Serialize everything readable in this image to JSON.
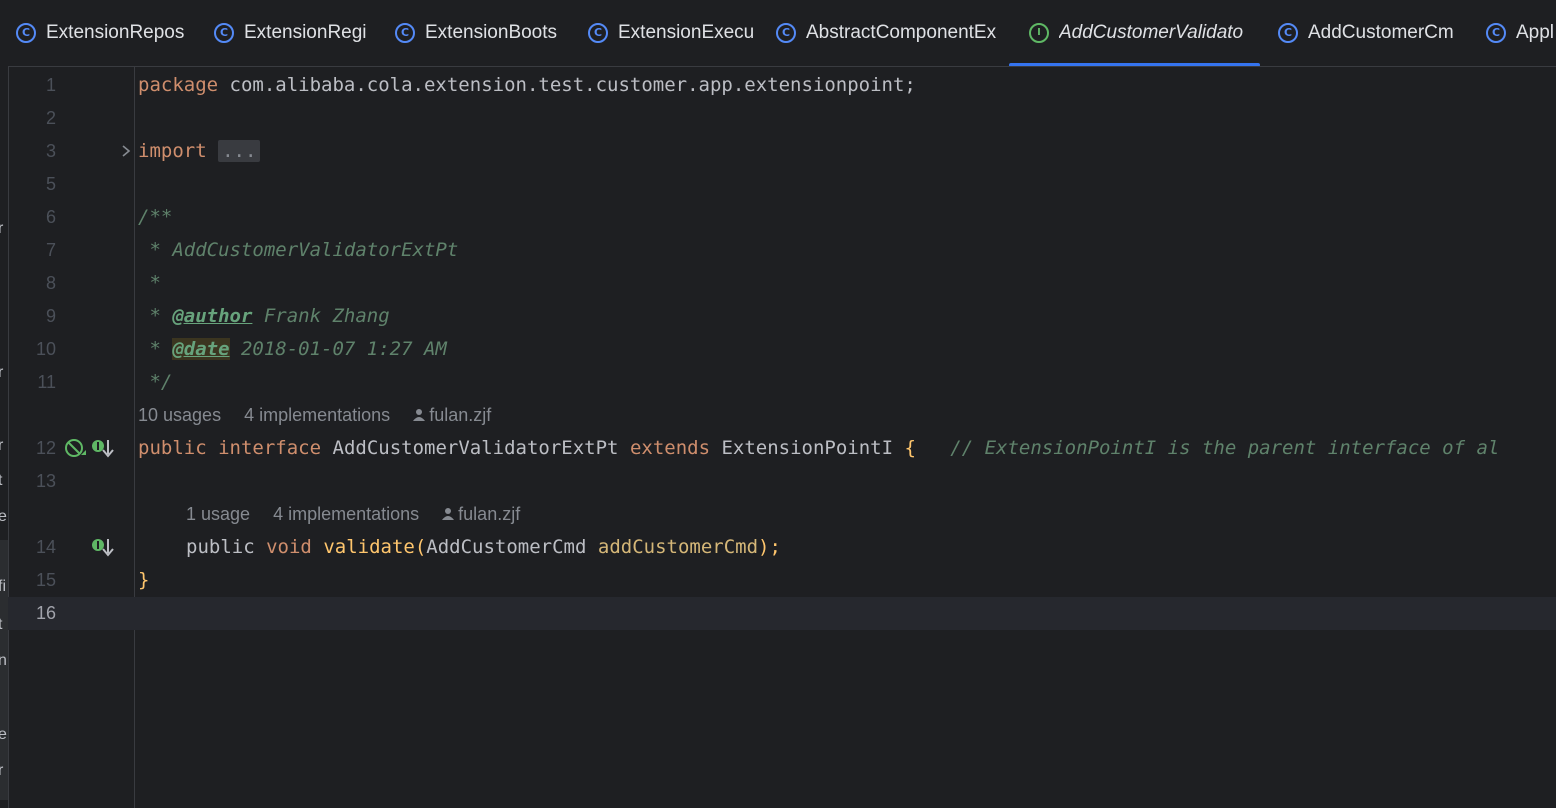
{
  "tabs": [
    {
      "label": "ExtensionRepos",
      "kind": "class"
    },
    {
      "label": "ExtensionRegi",
      "kind": "class"
    },
    {
      "label": "ExtensionBoots",
      "kind": "class"
    },
    {
      "label": "ExtensionExecu",
      "kind": "class"
    },
    {
      "label": "AbstractComponentEx",
      "kind": "class"
    },
    {
      "label": "AddCustomerValidato",
      "kind": "interface",
      "active": true
    },
    {
      "label": "AddCustomerCm",
      "kind": "class"
    },
    {
      "label": "Appl",
      "kind": "class-runnable"
    }
  ],
  "left_strip_fragments": [
    "r",
    "r",
    "r",
    "t",
    "e",
    "fi",
    "t",
    "n",
    "e",
    "r"
  ],
  "editor": {
    "current_line": "16",
    "lines": [
      {
        "num": "1",
        "package_kw": "package",
        "package_name": "com.alibaba.cola.extension.test.customer.app.extensionpoint;"
      },
      {
        "num": "2"
      },
      {
        "num": "3",
        "import_kw": "import",
        "folded": "..."
      },
      {
        "num": "5"
      },
      {
        "num": "6",
        "text": "/**"
      },
      {
        "num": "7",
        "text": " * AddCustomerValidatorExtPt"
      },
      {
        "num": "8",
        "text": " *"
      },
      {
        "num": "9",
        "prefix": " * ",
        "tag": "@author",
        "rest": " Frank Zhang"
      },
      {
        "num": "10",
        "prefix": " * ",
        "tag": "@date",
        "rest": " 2018-01-07 1:27 AM"
      },
      {
        "num": "11",
        "text": " */"
      },
      {
        "num": "12",
        "kw1": "public",
        "kw2": "interface",
        "name": "AddCustomerValidatorExtPt",
        "kw3": "extends",
        "super": "ExtensionPointI",
        "brace": "{",
        "comment": "// ExtensionPointI is the parent interface of al"
      },
      {
        "num": "13"
      },
      {
        "num": "14",
        "kw1": "public",
        "kw2": "void",
        "method": "validate",
        "paren_open": "(",
        "ptype": "AddCustomerCmd",
        "pname": "addCustomerCmd",
        "paren_close": ");"
      },
      {
        "num": "15",
        "text": "}"
      },
      {
        "num": "16"
      }
    ],
    "hint_interface": {
      "usages": "10 usages",
      "implementations": "4 implementations",
      "author": "fulan.zjf"
    },
    "hint_method": {
      "usages": "1 usage",
      "implementations": "4 implementations",
      "author": "fulan.zjf"
    }
  },
  "colors": {
    "accent": "#3574f0",
    "keyword": "#cf8e6d",
    "comment": "#5f826b",
    "background": "#1e1f22"
  }
}
